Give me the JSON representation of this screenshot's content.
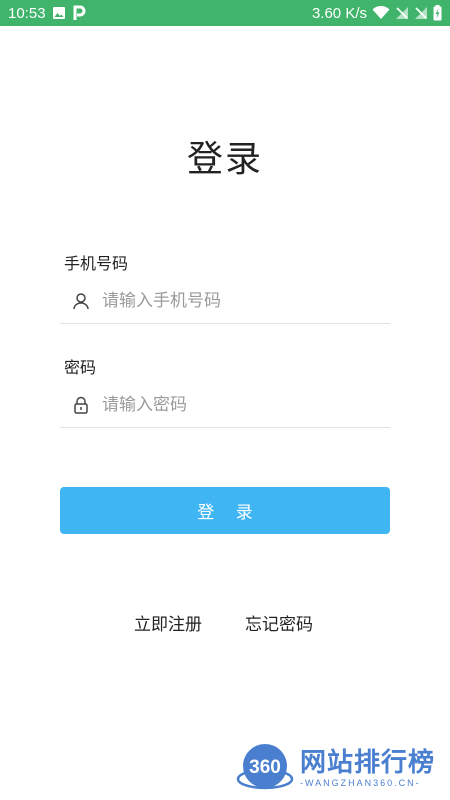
{
  "status_bar": {
    "time": "10:53",
    "network_speed": "3.60 K/s",
    "background_color": "#3fb46a",
    "left_icons": [
      "image-icon",
      "p-app-icon"
    ],
    "right_icons": [
      "wifi-icon",
      "no-sim-icon",
      "no-sim-icon",
      "battery-charging-icon"
    ]
  },
  "page": {
    "title": "登录"
  },
  "phone_field": {
    "label": "手机号码",
    "placeholder": "请输入手机号码",
    "value": "",
    "icon": "user-icon"
  },
  "password_field": {
    "label": "密码",
    "placeholder": "请输入密码",
    "value": "",
    "icon": "lock-icon"
  },
  "login_button": {
    "label": "登 录",
    "color": "#3fb6f3"
  },
  "links": {
    "register": "立即注册",
    "forgot_password": "忘记密码"
  },
  "watermark": {
    "logo_text": "360",
    "title": "网站排行榜",
    "subtitle": "-WANGZHAN360.CN-",
    "color": "#4a7fd0"
  }
}
